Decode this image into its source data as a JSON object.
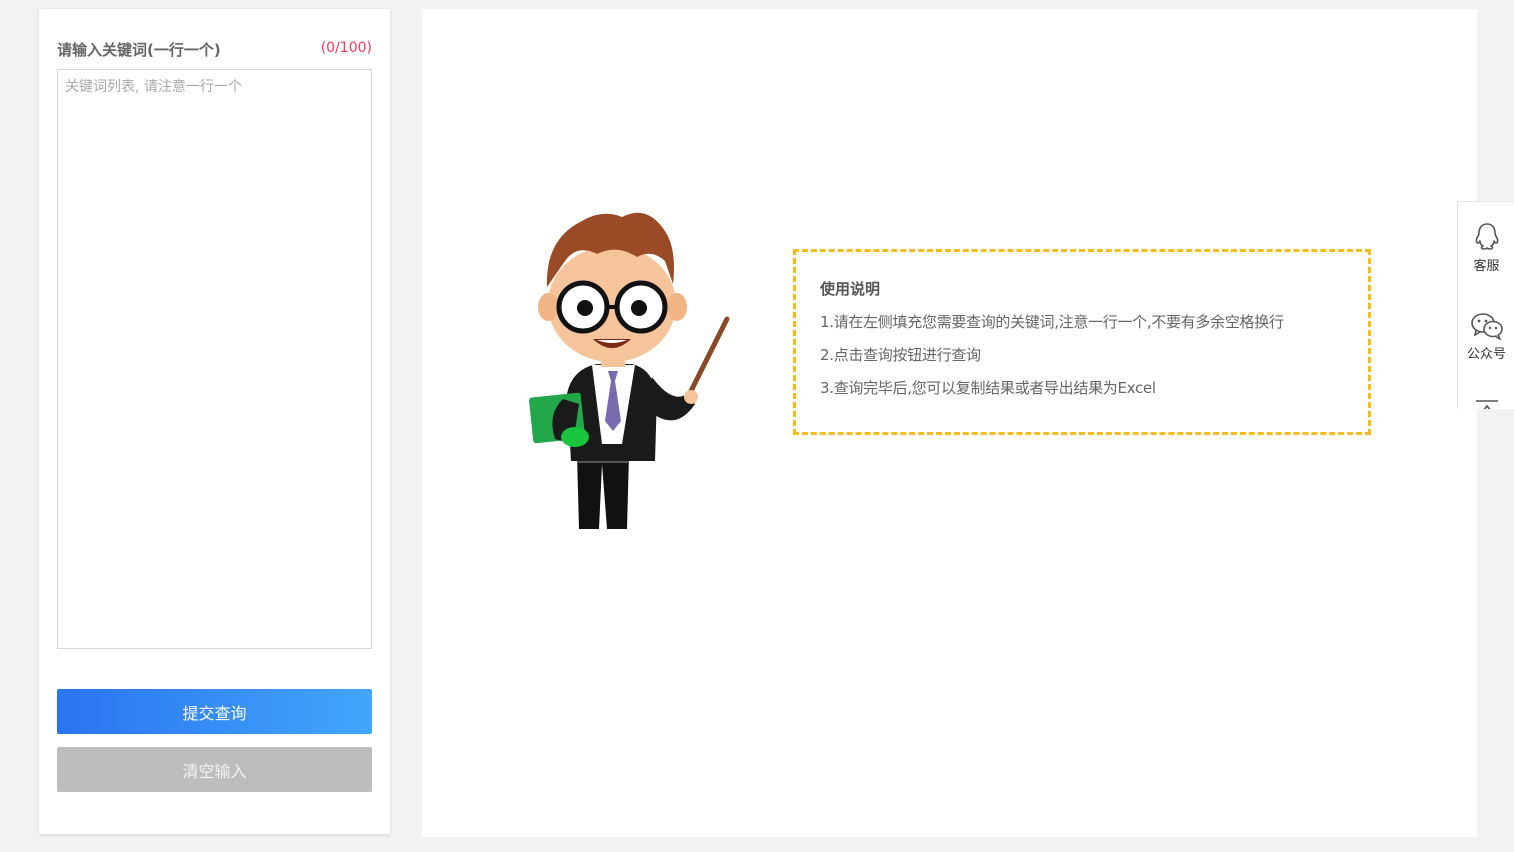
{
  "left": {
    "title": "请输入关键词(一行一个)",
    "counter": "(0/100)",
    "textarea_value": "",
    "textarea_placeholder": "关键词列表, 请注意一行一个",
    "submit_label": "提交查询",
    "clear_label": "清空输入"
  },
  "guide": {
    "title": "使用说明",
    "items": [
      "1.请在左侧填充您需要查询的关键词,注意一行一个,不要有多余空格换行",
      "2.点击查询按钮进行查询",
      "3.查询完毕后,您可以复制结果或者导出结果为Excel"
    ]
  },
  "sidebar": {
    "service_label": "客服",
    "service_icon": "qq-icon",
    "official_label": "公众号",
    "official_icon": "wechat-icon",
    "top_icon": "back-to-top-icon"
  },
  "colors": {
    "accent_start": "#2a74f0",
    "accent_end": "#42a6fb",
    "counter_red": "#ee3b5a",
    "dashed_border": "#f5bc1c",
    "clear_button": "#bdbdbd"
  }
}
